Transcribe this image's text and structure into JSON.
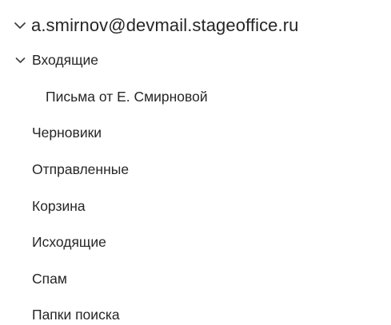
{
  "account": {
    "email": "a.smirnov@devmail.stageoffice.ru",
    "expanded_icon": "chevron-down-icon"
  },
  "folders": {
    "inbox": {
      "label": "Входящие",
      "expanded_icon": "chevron-down-icon"
    },
    "inbox_sub": {
      "label": "Письма от Е. Смирновой"
    },
    "drafts": {
      "label": "Черновики"
    },
    "sent": {
      "label": "Отправленные"
    },
    "trash": {
      "label": "Корзина"
    },
    "outbox": {
      "label": "Исходящие"
    },
    "spam": {
      "label": "Спам"
    },
    "search_folders": {
      "label": "Папки поиска"
    }
  },
  "colors": {
    "text": "#262626",
    "chevron": "#404040",
    "background": "#ffffff"
  }
}
